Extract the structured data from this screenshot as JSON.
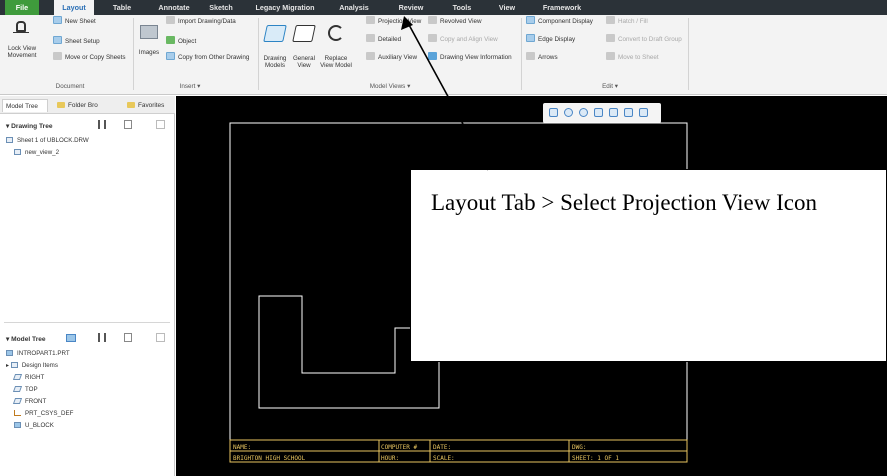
{
  "ribbon": {
    "tabs": [
      "File",
      "Layout",
      "Table",
      "Annotate",
      "Sketch",
      "Legacy Migration",
      "Analysis",
      "Review",
      "Tools",
      "View",
      "Framework"
    ],
    "document": {
      "lock_view": "Lock View",
      "movement": "Movement",
      "new_sheet": "New Sheet",
      "sheet_setup": "Sheet Setup",
      "move_copy": "Move or Copy Sheets",
      "group_label": "Document"
    },
    "insert": {
      "images": "Images",
      "import": "Import Drawing/Data",
      "object": "Object",
      "copy_from": "Copy from Other Drawing",
      "group_label": "Insert ▾"
    },
    "model_views": {
      "drawing_models": "Drawing",
      "drawing_models_2": "Models",
      "general_view": "General",
      "general_view_2": "View",
      "replace_view": "Replace",
      "replace_view_2": "View Model",
      "projection_view": "Projection View",
      "detailed_view": "Detailed",
      "auxiliary_view": "Auxiliary View",
      "revolved_view": "Revolved View",
      "copy_align": "Copy and Align View",
      "drawing_view_info": "Drawing View Information",
      "group_label": "Model Views ▾"
    },
    "edit": {
      "component_display": "Component Display",
      "edge_display": "Edge Display",
      "arrows": "Arrows",
      "hatch_fill": "Hatch / Fill",
      "convert_draft": "Convert to Draft Group",
      "move_to_sheet": "Move to Sheet",
      "group_label": "Edit ▾"
    }
  },
  "left_panel": {
    "tabs": [
      "Model Tree",
      "Folder Bro",
      "Favorites"
    ],
    "drawing_tree_title": "Drawing Tree",
    "drawing_items": [
      "Sheet 1 of UBLOCK.DRW",
      "new_view_2"
    ],
    "model_tree_title": "Model Tree",
    "model_items": [
      "INTROPART1.PRT",
      "Design Items",
      "RIGHT",
      "TOP",
      "FRONT",
      "PRT_CSYS_DEF",
      "U_BLOCK"
    ]
  },
  "title_block": {
    "name": "NAME:",
    "school": "BRIGHTON HIGH SCHOOL",
    "computer": "COMPUTER #",
    "hour": "HOUR:",
    "date": "DATE:",
    "scale": "SCALE:",
    "dwg": "DWG:",
    "sheet": "SHEET: 1 OF 1"
  },
  "callout": {
    "text": "Layout Tab > Select Projection View Icon"
  },
  "colors": {
    "accent": "#2a6fb5",
    "file_tab": "#3f9b3c",
    "title_block": "#e8c560",
    "sheet_border": "#ffffff"
  }
}
